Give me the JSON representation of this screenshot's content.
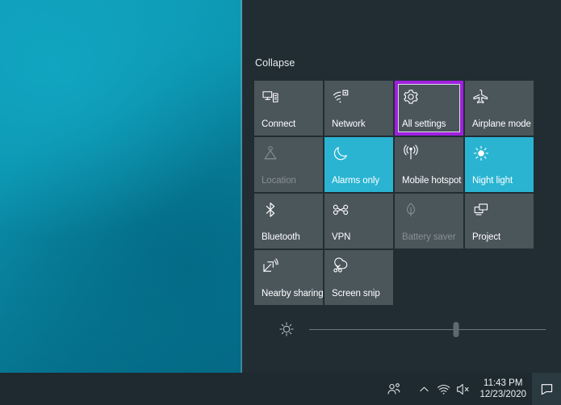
{
  "desktop": {
    "name": "windows-desktop-wallpaper"
  },
  "action_center": {
    "collapse_label": "Collapse",
    "accent_color": "#2ab4d2",
    "tile_color": "#4b565b",
    "panel_color": "#212d33",
    "focus_color": "#a020e0",
    "tiles": [
      {
        "label": "Connect",
        "icon": "connect-icon",
        "state": "off"
      },
      {
        "label": "Network",
        "icon": "network-wifi-icon",
        "state": "off"
      },
      {
        "label": "All settings",
        "icon": "gear-icon",
        "state": "off",
        "focused": true
      },
      {
        "label": "Airplane mode",
        "icon": "airplane-icon",
        "state": "off"
      },
      {
        "label": "Location",
        "icon": "location-pin-icon",
        "state": "disabled"
      },
      {
        "label": "Alarms only",
        "icon": "moon-icon",
        "state": "on"
      },
      {
        "label": "Mobile hotspot",
        "icon": "hotspot-icon",
        "state": "off"
      },
      {
        "label": "Night light",
        "icon": "sun-icon",
        "state": "on"
      },
      {
        "label": "Bluetooth",
        "icon": "bluetooth-icon",
        "state": "off"
      },
      {
        "label": "VPN",
        "icon": "vpn-icon",
        "state": "off"
      },
      {
        "label": "Battery saver",
        "icon": "leaf-icon",
        "state": "disabled"
      },
      {
        "label": "Project",
        "icon": "project-screens-icon",
        "state": "off"
      },
      {
        "label": "Nearby sharing",
        "icon": "nearby-share-icon",
        "state": "off"
      },
      {
        "label": "Screen snip",
        "icon": "screen-snip-icon",
        "state": "off"
      }
    ],
    "brightness": {
      "icon": "brightness-sun-icon",
      "value_percent": 62
    }
  },
  "taskbar": {
    "people_icon": "people-icon",
    "chevron_icon": "chevron-up-icon",
    "network_icon": "wifi-icon",
    "volume_icon": "speaker-muted-icon",
    "clock_time": "11:43 PM",
    "clock_date": "12/23/2020",
    "action_center_icon": "action-center-icon"
  }
}
